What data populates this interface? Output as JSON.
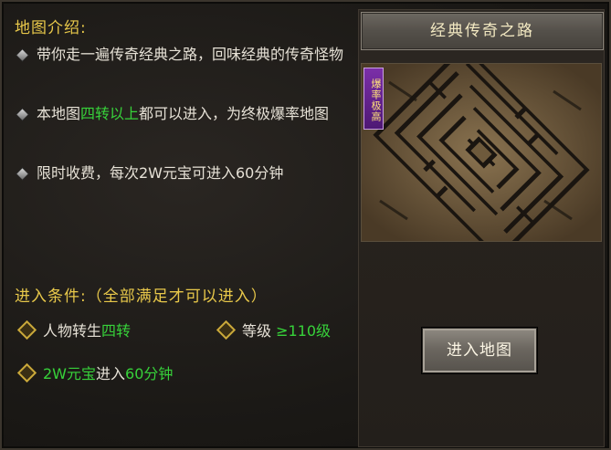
{
  "intro": {
    "title": "地图介绍:",
    "bullets": [
      {
        "parts": [
          "带你走一遍传奇经典之路，回味经典的传奇怪物"
        ]
      },
      {
        "parts": [
          "本地图",
          "四转以上",
          "都可以进入，为终极爆率地图"
        ]
      },
      {
        "parts": [
          "限时收费，每次2W元宝可进入60分钟"
        ]
      }
    ]
  },
  "conditions": {
    "title": "进入条件:（全部满足才可以进入）",
    "rebirth_label": "人物转生",
    "rebirth_value": "四转",
    "level_label": "等级",
    "level_value": "≥110级",
    "cost_value": "2W元宝",
    "cost_text": "进入",
    "cost_time": "60分钟"
  },
  "map": {
    "title": "经典传奇之路",
    "badge": "爆率极高"
  },
  "enter_button": "进入地图"
}
